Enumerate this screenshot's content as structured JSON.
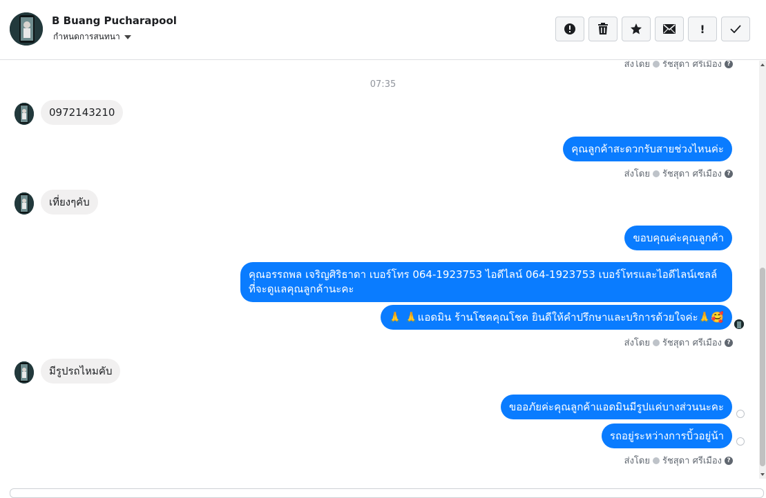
{
  "header": {
    "contact_name": "B Buang Pucharapool",
    "assign_label": "กำหนดการสนทนา",
    "toolbar": [
      {
        "name": "alert-icon",
        "label": "Spam"
      },
      {
        "name": "trash-icon",
        "label": "Delete"
      },
      {
        "name": "star-icon",
        "label": "Star"
      },
      {
        "name": "envelope-icon",
        "label": "Mark unread"
      },
      {
        "name": "exclamation-icon",
        "label": "Follow up"
      },
      {
        "name": "check-icon",
        "label": "Done"
      }
    ]
  },
  "messages": {
    "sent_by_prefix": "ส่งโดย",
    "sender_name": "รัชสุดา ศรีเมือง",
    "timestamp": "07:35",
    "incoming_1": "0972143210",
    "outgoing_1": "คุณลูกค้าสะดวกรับสายช่วงไหนค่ะ",
    "incoming_2": "เที่ยงๆคับ",
    "outgoing_2": "ขอบคุณค่ะคุณลูกค้า",
    "outgoing_3": "คุณอรรถพล เจริญศิริธาดา      เบอร์โทร 064-1923753 ไอดีไลน์ 064-1923753   เบอร์โทรและไอดีไลน์เซลล์ที่จะดูแลคุณลูกค้านะคะ",
    "outgoing_4": "🙏 🙏แอดมิน ร้านโชคคุณโชค ยินดีให้คำปรึกษาและบริการด้วยใจค่ะ🙏🥰",
    "incoming_3": "มีรูปรถไหมคับ",
    "outgoing_5": "ขออภัยค่ะคุณลูกค้าแอดมินมีรูปแค่บางส่วนนะคะ",
    "outgoing_6": "รถอยู่ระหว่างการบิ้วอยู่น้า"
  }
}
